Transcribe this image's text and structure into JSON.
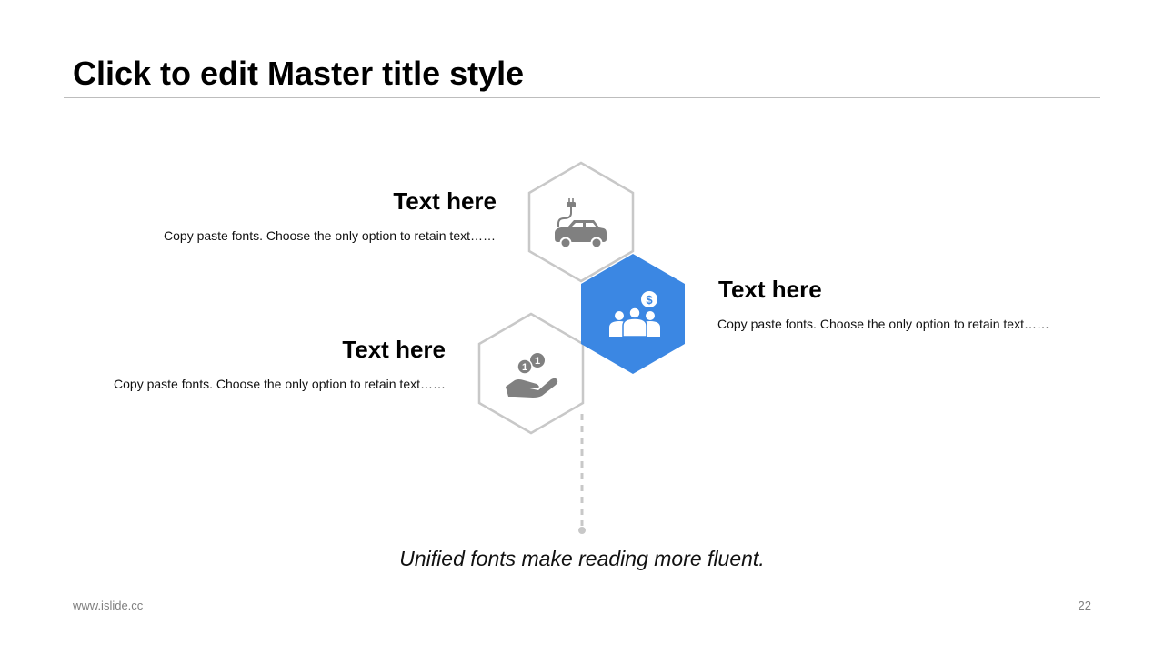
{
  "slide": {
    "title": "Click to edit Master title style",
    "caption": "Unified fonts make reading more fluent.",
    "footer_url": "www.islide.cc",
    "page_number": "22"
  },
  "items": [
    {
      "heading": "Text here",
      "text": "Copy paste fonts. Choose the only option to retain text……",
      "icon": "electric-car-icon"
    },
    {
      "heading": "Text here",
      "text": "Copy paste fonts. Choose the only option to retain text……",
      "icon": "people-money-icon"
    },
    {
      "heading": "Text here",
      "text": "Copy paste fonts. Choose the only option to retain text……",
      "icon": "hand-coins-icon"
    }
  ],
  "colors": {
    "accent": "#3b87e3",
    "outline": "#c8c8c8",
    "icon": "#808080"
  }
}
